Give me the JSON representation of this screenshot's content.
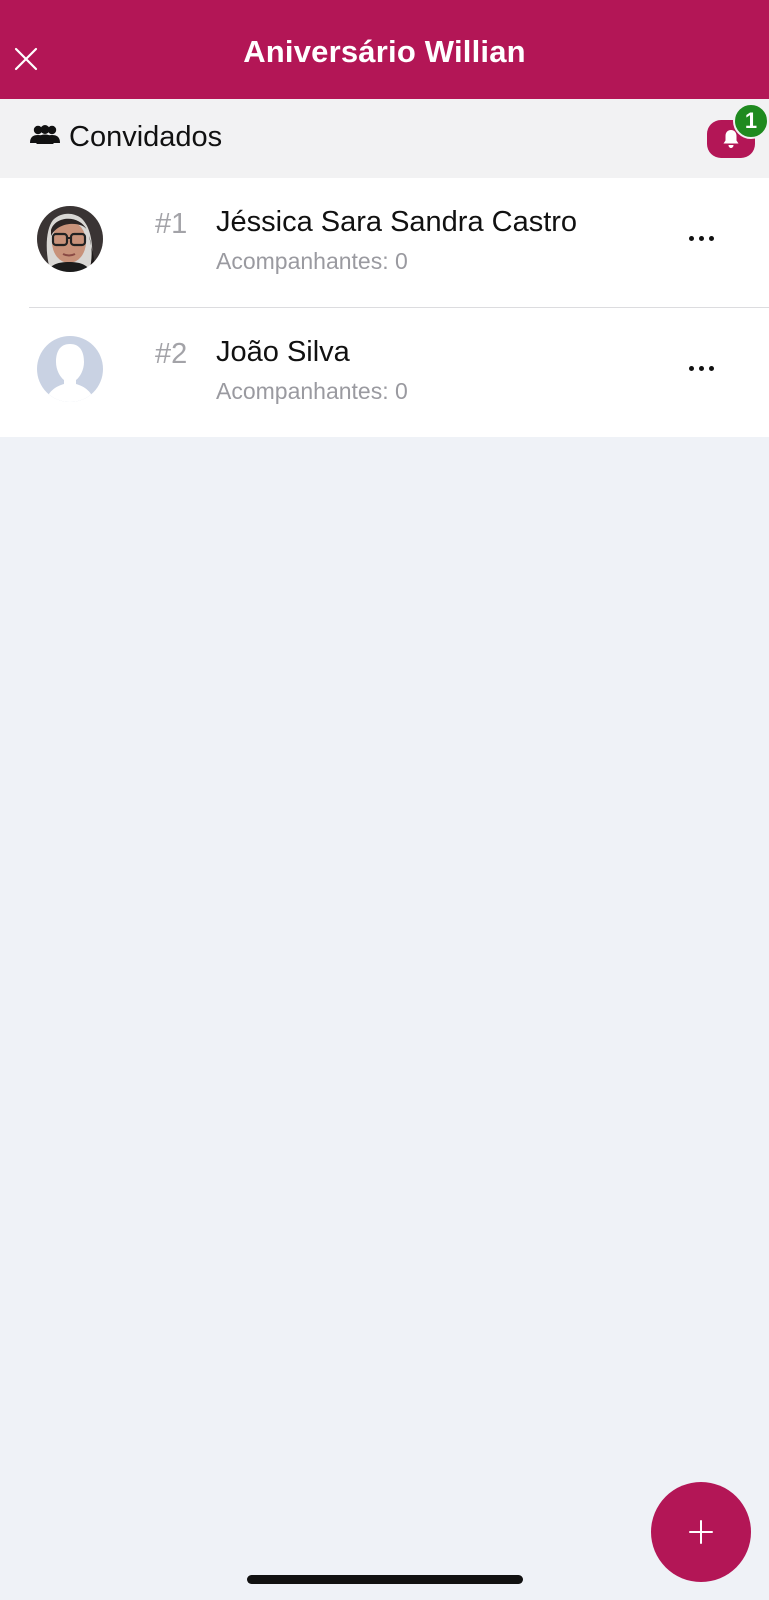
{
  "header": {
    "title": "Aniversário Willian",
    "close_icon": "close-icon",
    "background_color": "#b31656"
  },
  "section": {
    "icon": "people-icon",
    "title": "Convidados",
    "notifications": {
      "icon": "bell-icon",
      "badge_count": "1",
      "badge_color": "#1f8a1f"
    }
  },
  "guests": [
    {
      "index": "#1",
      "name": "Jéssica Sara Sandra Castro",
      "companions": "Acompanhantes: 0",
      "avatar": "photo-avatar",
      "menu_icon": "more-horizontal-icon"
    },
    {
      "index": "#2",
      "name": "João Silva",
      "companions": "Acompanhantes: 0",
      "avatar": "placeholder-avatar",
      "menu_icon": "more-horizontal-icon"
    }
  ],
  "fab": {
    "icon": "plus-icon"
  }
}
